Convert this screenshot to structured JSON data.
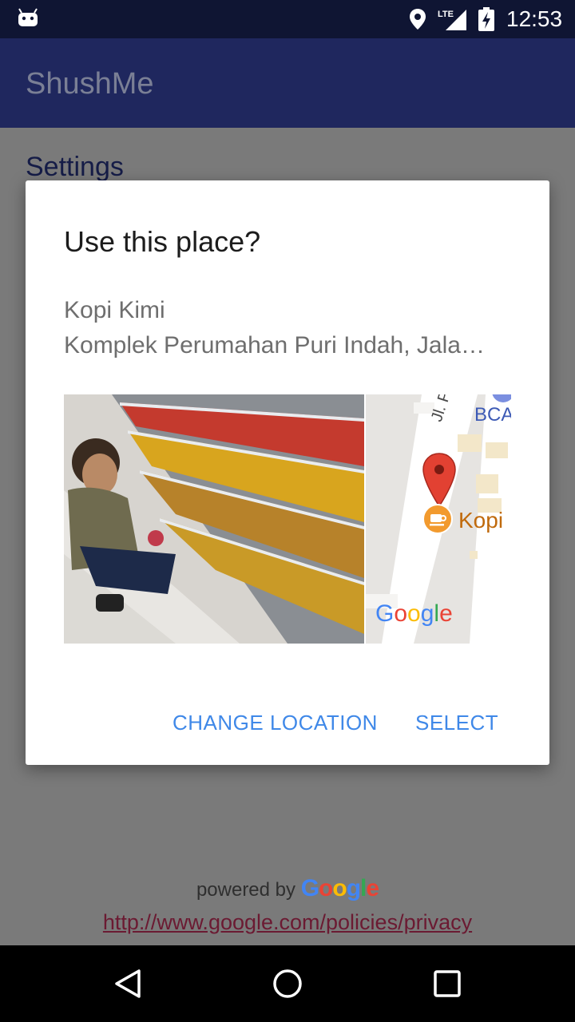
{
  "status_bar": {
    "time": "12:53",
    "network": "LTE",
    "icons": [
      "android-icon",
      "location-icon",
      "lte-signal-icon",
      "battery-charging-icon"
    ]
  },
  "app_bar": {
    "title": "ShushMe"
  },
  "background": {
    "settings_label": "Settings",
    "powered_by": "powered by",
    "powered_brand": "Google",
    "privacy_link": "http://www.google.com/policies/privacy"
  },
  "dialog": {
    "title": "Use this place?",
    "place_name": "Kopi Kimi",
    "place_address": "Komplek Perumahan Puri Indah, Jala…",
    "map": {
      "street_label": "Jl. Pd.",
      "poi_label": "BCA",
      "place_label": "Kopi I",
      "watermark": "Google"
    },
    "buttons": {
      "change_location": "CHANGE LOCATION",
      "select": "SELECT"
    }
  },
  "colors": {
    "status_bar": "#0f1533",
    "app_bar": "#1f275e",
    "scrim": "#7a7a7a",
    "accent": "#3f88e8",
    "link": "#6b1a32",
    "google_blue": "#4285f4",
    "google_red": "#ea4335",
    "google_yellow": "#fbbc05",
    "google_green": "#34a853"
  }
}
